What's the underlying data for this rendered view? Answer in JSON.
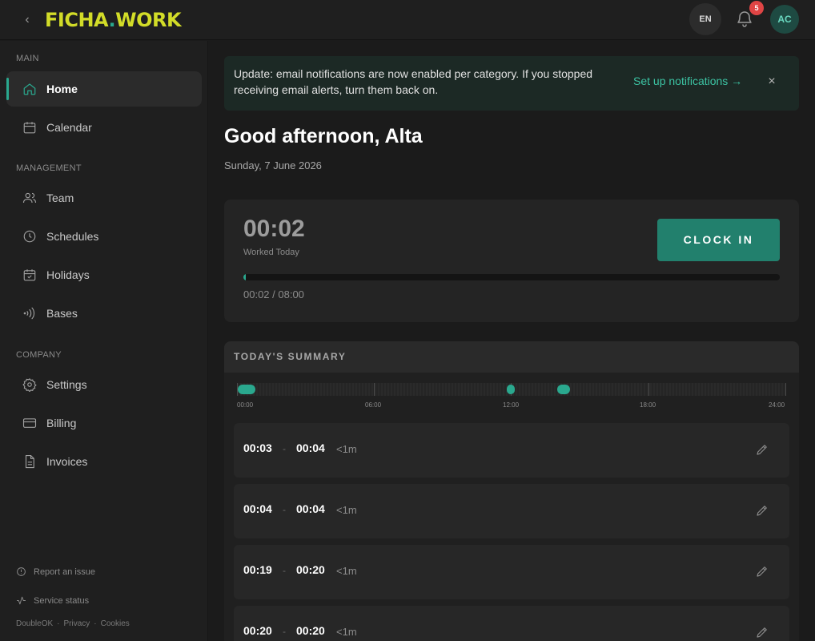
{
  "topbar": {
    "back_icon": "chevron-left-icon",
    "logo_main": "FICHA",
    "logo_dot": ".",
    "logo_tail": "WORK",
    "language": "EN",
    "notification_count": "5",
    "avatar_initials": "AC"
  },
  "sidebar": {
    "sections": {
      "main": "MAIN",
      "management": "MANAGEMENT",
      "company": "COMPANY"
    },
    "items": [
      {
        "label": "Home",
        "icon": "home-icon",
        "active": true
      },
      {
        "label": "Calendar",
        "icon": "calendar-icon"
      },
      {
        "label": "Team",
        "icon": "team-icon"
      },
      {
        "label": "Schedules",
        "icon": "clock-icon"
      },
      {
        "label": "Holidays",
        "icon": "calendar-check-icon"
      },
      {
        "label": "Bases",
        "icon": "signal-icon"
      },
      {
        "label": "Settings",
        "icon": "gear-icon"
      },
      {
        "label": "Billing",
        "icon": "credit-card-icon"
      },
      {
        "label": "Invoices",
        "icon": "document-icon"
      }
    ],
    "footer": {
      "report": "Report an issue",
      "status": "Service status",
      "legal": [
        "DoubleOK",
        "Privacy",
        "Cookies"
      ],
      "separator": "·"
    }
  },
  "banner": {
    "text": "Update: email notifications are now enabled per category. If you stopped receiving email alerts, turn them back on.",
    "link": "Set up notifications →",
    "close": "×"
  },
  "greeting": "Good afternoon, Alta",
  "date": "Sunday, 7 June 2026",
  "clock": {
    "worked_time": "00:02",
    "worked_label": "Worked Today",
    "button": "CLOCK IN",
    "progress_text": "00:02 / 08:00",
    "progress_fraction": 0.0042
  },
  "summary": {
    "title": "TODAY'S SUMMARY",
    "axis_labels": [
      "00:00",
      "06:00",
      "12:00",
      "18:00",
      "24:00"
    ],
    "entries": [
      {
        "start": "00:03",
        "sep": "-",
        "end": "00:04",
        "duration": "<1m"
      },
      {
        "start": "00:04",
        "sep": "-",
        "end": "00:04",
        "duration": "<1m"
      },
      {
        "start": "00:19",
        "sep": "-",
        "end": "00:20",
        "duration": "<1m"
      },
      {
        "start": "00:20",
        "sep": "-",
        "end": "00:20",
        "duration": "<1m"
      }
    ]
  },
  "colors": {
    "accent": "#2aa88e",
    "logo": "#d2dc28",
    "badge": "#e04545",
    "button": "#22806d"
  }
}
